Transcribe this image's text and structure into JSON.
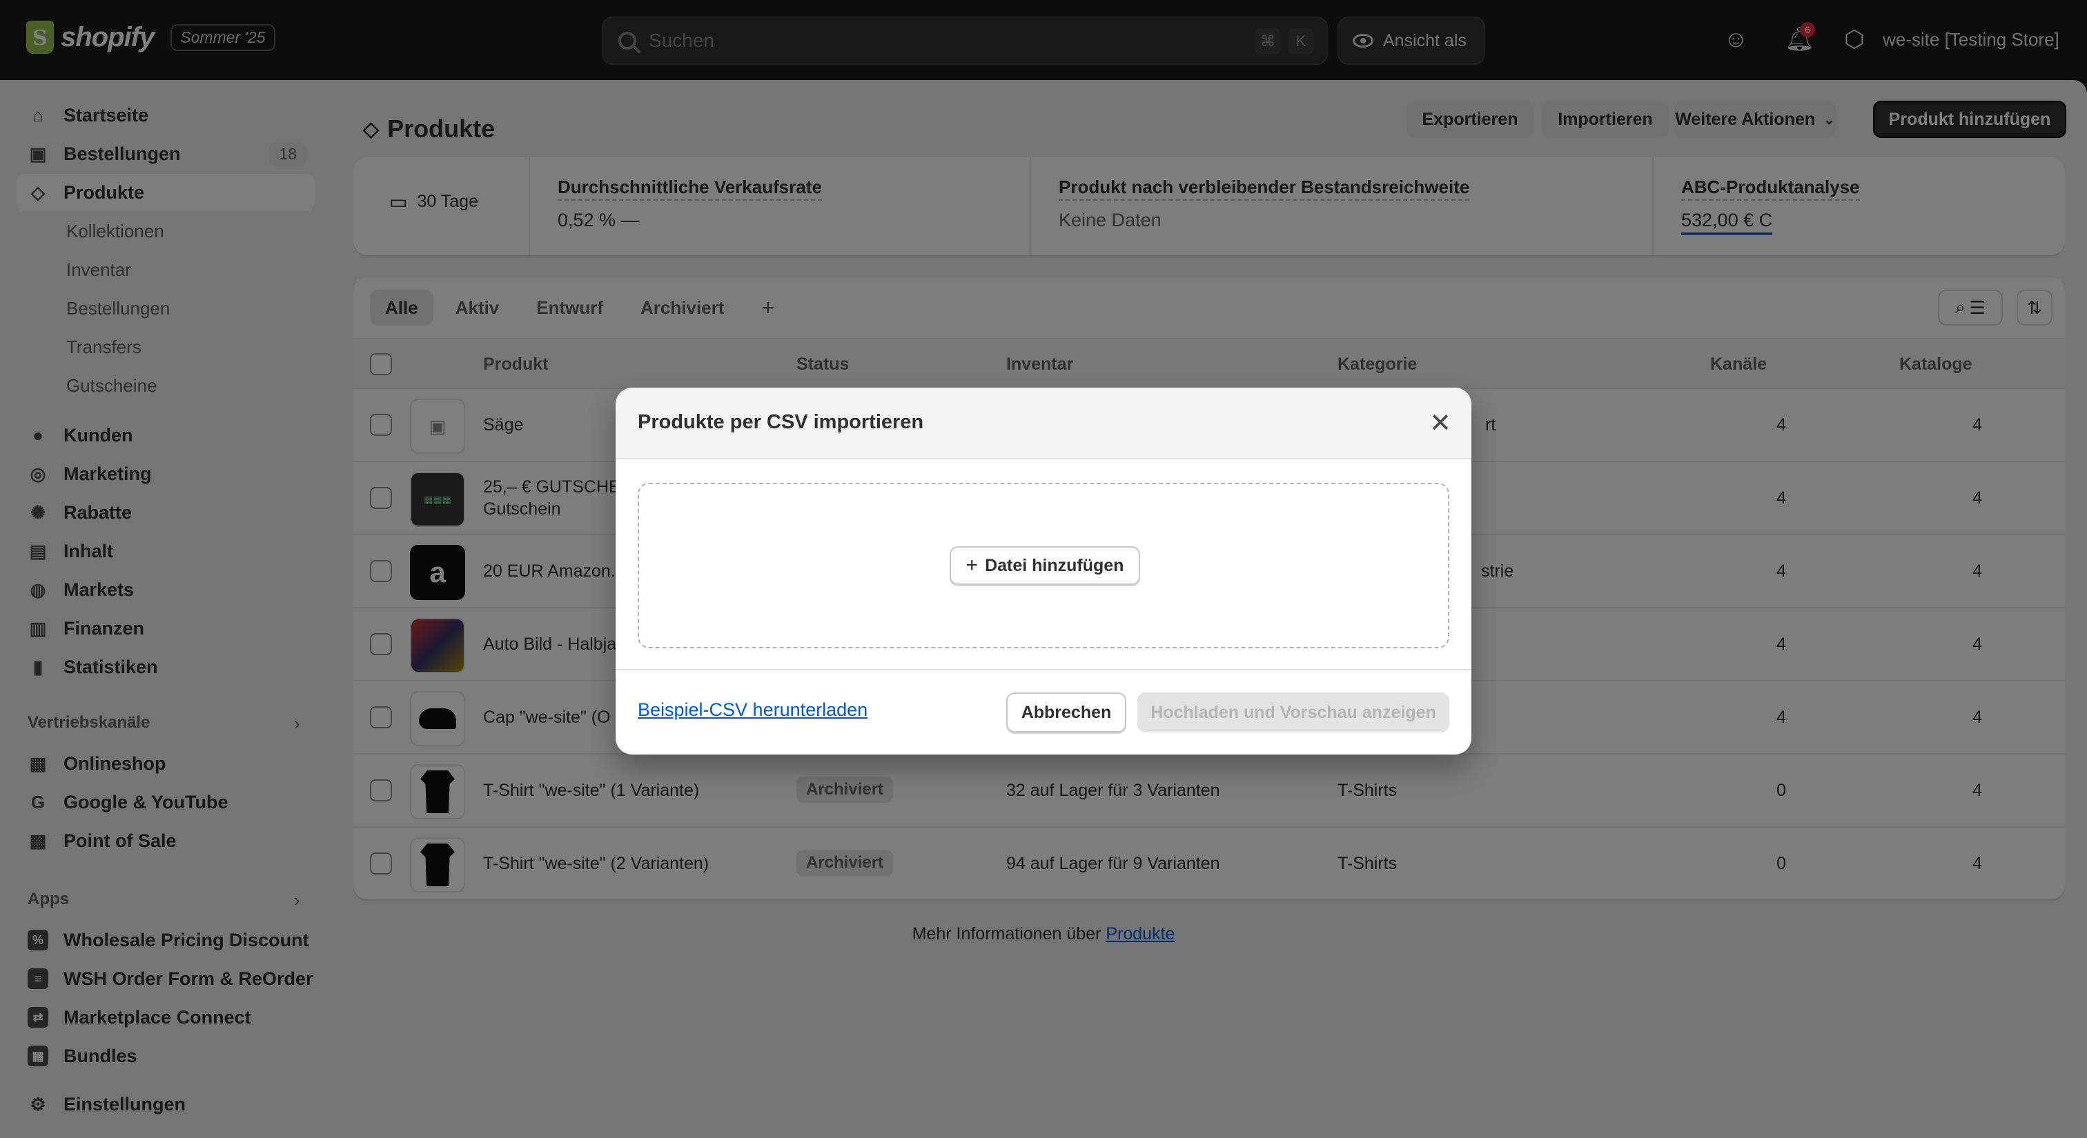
{
  "topbar": {
    "brand": "shopify",
    "edition": "Sommer '25",
    "search_placeholder": "Suchen",
    "shortcut_keys": [
      "⌘",
      "K"
    ],
    "view_as": "Ansicht als",
    "notification_count": "6",
    "store_name": "we-site [Testing Store]"
  },
  "sidebar": {
    "items": [
      {
        "label": "Startseite",
        "icon": "home-icon"
      },
      {
        "label": "Bestellungen",
        "icon": "inbox-icon",
        "badge": "18"
      },
      {
        "label": "Produkte",
        "icon": "tag-icon",
        "active": true
      }
    ],
    "sub_items": [
      "Kollektionen",
      "Inventar",
      "Bestellungen",
      "Transfers",
      "Gutscheine"
    ],
    "items2": [
      {
        "label": "Kunden",
        "icon": "person-icon"
      },
      {
        "label": "Marketing",
        "icon": "target-icon"
      },
      {
        "label": "Rabatte",
        "icon": "discount-icon"
      },
      {
        "label": "Inhalt",
        "icon": "image-icon"
      },
      {
        "label": "Markets",
        "icon": "globe-icon"
      },
      {
        "label": "Finanzen",
        "icon": "bank-icon"
      },
      {
        "label": "Statistiken",
        "icon": "chart-icon"
      }
    ],
    "sales_channels_title": "Vertriebskanäle",
    "sales_channels": [
      "Onlineshop",
      "Google & YouTube",
      "Point of Sale"
    ],
    "apps_title": "Apps",
    "apps": [
      "Wholesale Pricing Discount",
      "WSH Order Form & ReOrder",
      "Marketplace Connect",
      "Bundles"
    ],
    "settings": "Einstellungen"
  },
  "page": {
    "title": "Produkte",
    "actions": {
      "export": "Exportieren",
      "import": "Importieren",
      "more": "Weitere Aktionen",
      "add": "Produkt hinzufügen"
    }
  },
  "stats": {
    "period": "30 Tage",
    "cells": [
      {
        "label": "Durchschnittliche Verkaufsrate",
        "value": "0,52 %  —"
      },
      {
        "label": "Produkt nach verbleibender Bestandsreichweite",
        "value": "Keine Daten"
      },
      {
        "label": "ABC-Produktanalyse",
        "value": "532,00 € C"
      }
    ]
  },
  "table": {
    "tabs": [
      "Alle",
      "Aktiv",
      "Entwurf",
      "Archiviert",
      "+"
    ],
    "columns": [
      "Produkt",
      "Status",
      "Inventar",
      "Kategorie",
      "Kanäle",
      "Kataloge"
    ],
    "rows": [
      {
        "name": "Säge",
        "name2": "",
        "status": "",
        "inventory": "",
        "category": "rt",
        "channels": "4",
        "catalogs": "4"
      },
      {
        "name": "25,– € GUTSCHE",
        "name2": "Gutschein",
        "status": "",
        "inventory": "",
        "category": "",
        "channels": "4",
        "catalogs": "4"
      },
      {
        "name": "20 EUR Amazon.",
        "name2": "",
        "status": "",
        "inventory": "",
        "category": "strie",
        "channels": "4",
        "catalogs": "4"
      },
      {
        "name": "Auto Bild - Halbja",
        "name2": "",
        "status": "",
        "inventory": "",
        "category": "",
        "channels": "4",
        "catalogs": "4"
      },
      {
        "name": "Cap \"we-site\" (O",
        "name2": "",
        "status": "",
        "inventory": "",
        "category": "",
        "channels": "4",
        "catalogs": "4"
      },
      {
        "name": "T-Shirt \"we-site\" (1 Variante)",
        "name2": "",
        "status": "Archiviert",
        "inventory": "32 auf Lager für 3 Varianten",
        "category": "T-Shirts",
        "channels": "0",
        "catalogs": "4"
      },
      {
        "name": "T-Shirt \"we-site\" (2 Varianten)",
        "name2": "",
        "status": "Archiviert",
        "inventory": "94 auf Lager für 9 Varianten",
        "category": "T-Shirts",
        "channels": "0",
        "catalogs": "4"
      }
    ],
    "footer_text": "Mehr Informationen über",
    "footer_link": "Produkte"
  },
  "modal": {
    "title": "Produkte per CSV importieren",
    "add_file": "Datei hinzufügen",
    "sample_link": "Beispiel-CSV herunterladen",
    "cancel": "Abbrechen",
    "upload": "Hochladen und Vorschau anzeigen"
  }
}
